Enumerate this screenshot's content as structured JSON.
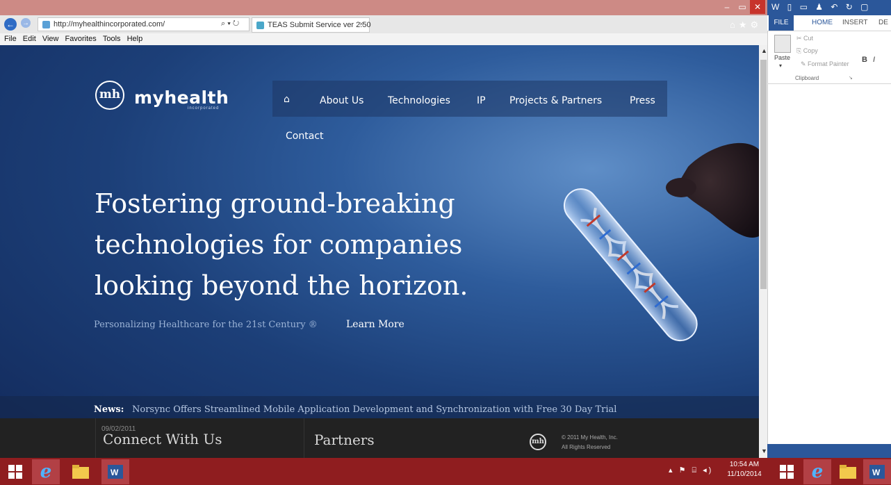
{
  "browser": {
    "address_url": "http://myhealthincorporated.com/",
    "address_tools": "⌕ ▾ ↻",
    "tab_title": "TEAS Submit Service ver 2.50",
    "tab_close": "×",
    "menu": [
      "File",
      "Edit",
      "View",
      "Favorites",
      "Tools",
      "Help"
    ],
    "window_controls": [
      "–",
      "▭",
      "✕"
    ],
    "right_icons": "⌂★⚙"
  },
  "site": {
    "logo_mark": "mh",
    "logo_text": "myhealth",
    "logo_sub": "incorporated",
    "nav": {
      "home": "⌂",
      "about": "About Us",
      "technologies": "Technologies",
      "ip": "IP",
      "projects": "Projects & Partners",
      "press": "Press",
      "contact": "Contact"
    },
    "headline": "Fostering ground-breaking technologies for companies looking beyond the horizon.",
    "tagline": "Personalizing Healthcare for the 21st Century ®",
    "learn_more": "Learn More",
    "news_label": "News:",
    "news_text": "Norsync Offers Streamlined Mobile Application Development and Synchronization with Free 30 Day Trial",
    "footer": {
      "date": "09/02/2011",
      "connect": "Connect With Us",
      "partners": "Partners",
      "logo_mark": "mh",
      "copyright": "© 2011 My Health, Inc.",
      "rights": "All Rights Reserved"
    }
  },
  "word": {
    "qat": "W ▯ ▭ ♟ ↶ ↻ ▢",
    "tabs": {
      "file": "FILE",
      "home": "HOME",
      "insert": "INSERT",
      "de": "DE"
    },
    "clipboard": {
      "paste": "Paste",
      "paste_arrow": "▾",
      "cut": "✂ Cut",
      "copy": "⎘ Copy",
      "format_painter": "✎ Format Painter",
      "group_label": "Clipboard",
      "launcher": "↘"
    },
    "font": {
      "bold": "B",
      "italic": "I"
    }
  },
  "taskbar": {
    "tray_icons": "▴ ⚑ ⌸ ◂)",
    "time": "10:54 AM",
    "date": "11/10/2014"
  },
  "colors": {
    "ie_titlebar": "#cd8a85",
    "taskbar": "#8f1d1f",
    "word_blue": "#2b579a",
    "page_blue": "#1c3f78"
  }
}
